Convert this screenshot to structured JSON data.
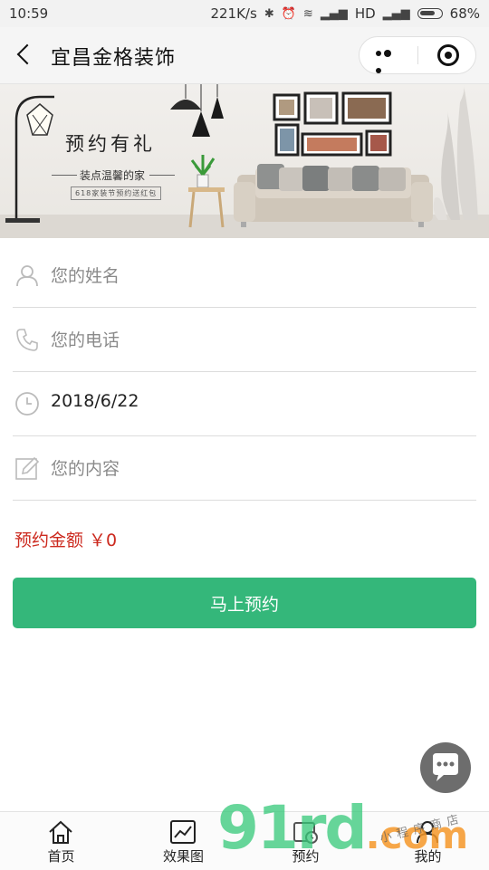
{
  "status_bar": {
    "time": "10:59",
    "network_speed": "221K/s",
    "network_type": "HD",
    "battery": "68%"
  },
  "nav": {
    "title": "宜昌金格装饰"
  },
  "banner": {
    "title": "预约有礼",
    "subtitle": "装点温馨的家",
    "tag": "618家装节预约送红包"
  },
  "form": {
    "name_placeholder": "您的姓名",
    "phone_placeholder": "您的电话",
    "date_value": "2018/6/22",
    "content_placeholder": "您的内容"
  },
  "amount": {
    "label": "预约金额",
    "value": "￥0",
    "color": "#cc2a1f"
  },
  "submit_label": "马上预约",
  "accent_color": "#34b77a",
  "tabbar": {
    "tabs": [
      {
        "label": "首页",
        "icon": "home-icon"
      },
      {
        "label": "效果图",
        "icon": "chart-icon"
      },
      {
        "label": "预约",
        "icon": "calendar-icon"
      },
      {
        "label": "我的",
        "icon": "user-icon"
      }
    ]
  },
  "watermark": {
    "main": "91rd",
    "suffix": ".com",
    "small": "小程序商店"
  }
}
